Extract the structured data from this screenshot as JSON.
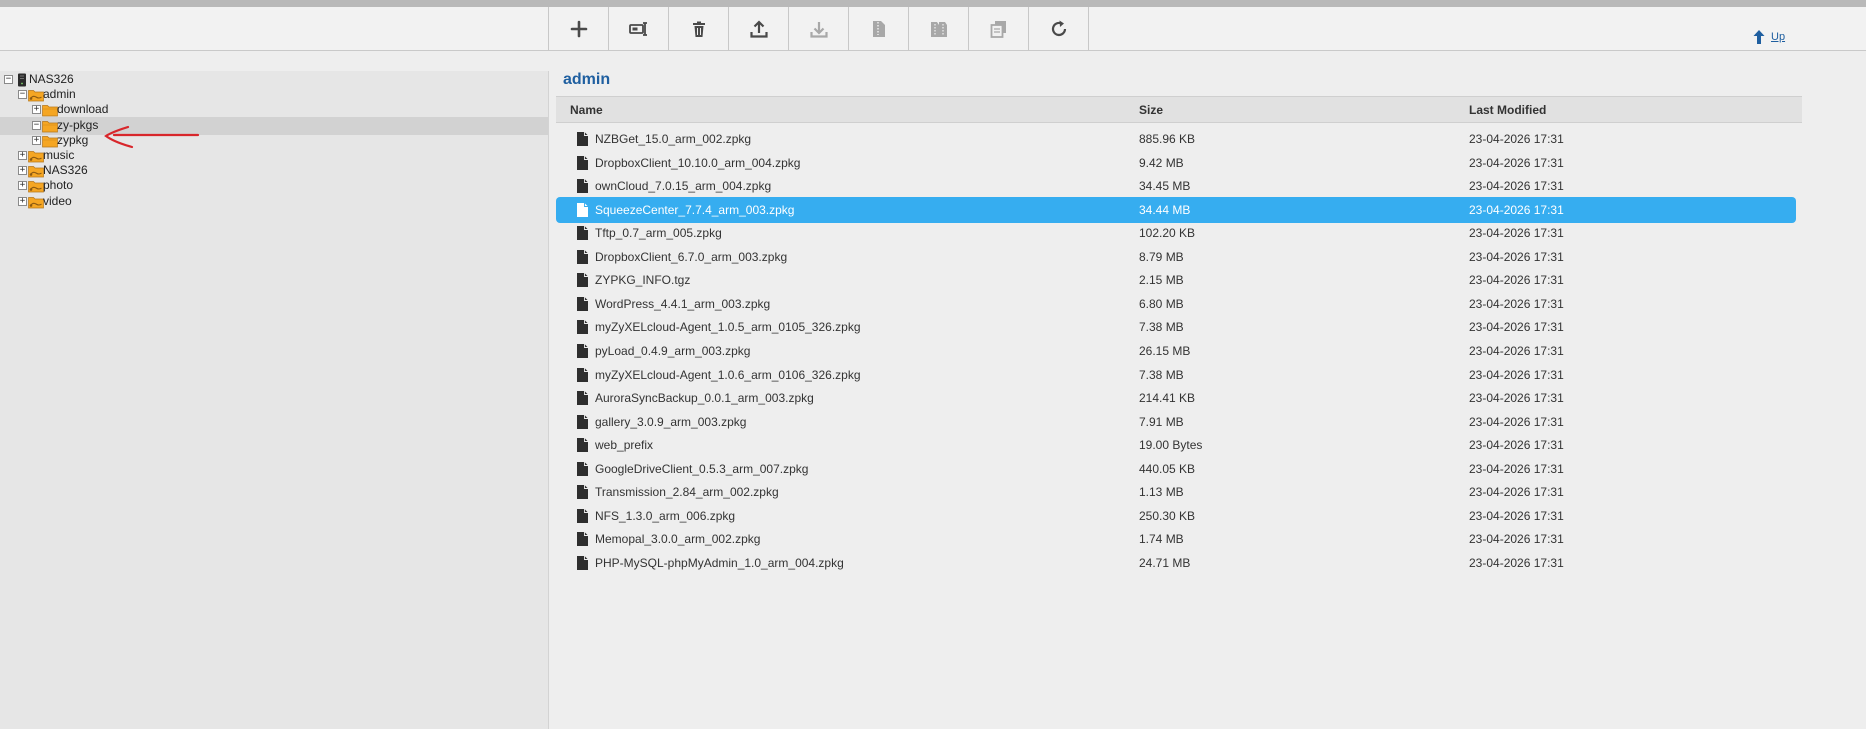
{
  "toolbar": {
    "buttons": [
      {
        "name": "add-button",
        "icon": "plus-icon",
        "enabled": true
      },
      {
        "name": "rename-button",
        "icon": "rename-icon",
        "enabled": true
      },
      {
        "name": "delete-button",
        "icon": "trash-icon",
        "enabled": true
      },
      {
        "name": "upload-button",
        "icon": "upload-icon",
        "enabled": true
      },
      {
        "name": "download-button",
        "icon": "download-icon",
        "enabled": false
      },
      {
        "name": "zip-button",
        "icon": "zip-icon",
        "enabled": false
      },
      {
        "name": "unzip-button",
        "icon": "unzip-icon",
        "enabled": false
      },
      {
        "name": "copy-move-button",
        "icon": "copy-icon",
        "enabled": false
      },
      {
        "name": "refresh-button",
        "icon": "refresh-icon",
        "enabled": true
      }
    ],
    "up_label": "Up"
  },
  "tree": {
    "items": [
      {
        "label": "NAS326",
        "level": 0,
        "expander": "−",
        "icon": "nas-icon"
      },
      {
        "label": "admin",
        "level": 1,
        "expander": "−",
        "icon": "shared-folder-icon"
      },
      {
        "label": "download",
        "level": 2,
        "expander": "+",
        "icon": "folder-icon"
      },
      {
        "label": "zy-pkgs",
        "level": 2,
        "expander": "−",
        "icon": "folder-icon",
        "selected": true
      },
      {
        "label": "zypkg",
        "level": 2,
        "expander": "+",
        "icon": "folder-icon"
      },
      {
        "label": "music",
        "level": 1,
        "expander": "+",
        "icon": "shared-folder-icon"
      },
      {
        "label": "NAS326",
        "level": 1,
        "expander": "+",
        "icon": "shared-folder-icon"
      },
      {
        "label": "photo",
        "level": 1,
        "expander": "+",
        "icon": "shared-folder-icon"
      },
      {
        "label": "video",
        "level": 1,
        "expander": "+",
        "icon": "shared-folder-icon"
      }
    ]
  },
  "main": {
    "folder_title": "admin",
    "columns": {
      "name": "Name",
      "size": "Size",
      "modified": "Last Modified"
    },
    "files": [
      {
        "name": "NZBGet_15.0_arm_002.zpkg",
        "size": "885.96 KB",
        "modified": "23-04-2026 17:31"
      },
      {
        "name": "DropboxClient_10.10.0_arm_004.zpkg",
        "size": "9.42 MB",
        "modified": "23-04-2026 17:31"
      },
      {
        "name": "ownCloud_7.0.15_arm_004.zpkg",
        "size": "34.45 MB",
        "modified": "23-04-2026 17:31"
      },
      {
        "name": "SqueezeCenter_7.7.4_arm_003.zpkg",
        "size": "34.44 MB",
        "modified": "23-04-2026 17:31",
        "selected": true
      },
      {
        "name": "Tftp_0.7_arm_005.zpkg",
        "size": "102.20 KB",
        "modified": "23-04-2026 17:31"
      },
      {
        "name": "DropboxClient_6.7.0_arm_003.zpkg",
        "size": "8.79 MB",
        "modified": "23-04-2026 17:31"
      },
      {
        "name": "ZYPKG_INFO.tgz",
        "size": "2.15 MB",
        "modified": "23-04-2026 17:31"
      },
      {
        "name": "WordPress_4.4.1_arm_003.zpkg",
        "size": "6.80 MB",
        "modified": "23-04-2026 17:31"
      },
      {
        "name": "myZyXELcloud-Agent_1.0.5_arm_0105_326.zpkg",
        "size": "7.38 MB",
        "modified": "23-04-2026 17:31"
      },
      {
        "name": "pyLoad_0.4.9_arm_003.zpkg",
        "size": "26.15 MB",
        "modified": "23-04-2026 17:31"
      },
      {
        "name": "myZyXELcloud-Agent_1.0.6_arm_0106_326.zpkg",
        "size": "7.38 MB",
        "modified": "23-04-2026 17:31"
      },
      {
        "name": "AuroraSyncBackup_0.0.1_arm_003.zpkg",
        "size": "214.41 KB",
        "modified": "23-04-2026 17:31"
      },
      {
        "name": "gallery_3.0.9_arm_003.zpkg",
        "size": "7.91 MB",
        "modified": "23-04-2026 17:31"
      },
      {
        "name": "web_prefix",
        "size": "19.00 Bytes",
        "modified": "23-04-2026 17:31"
      },
      {
        "name": "GoogleDriveClient_0.5.3_arm_007.zpkg",
        "size": "440.05 KB",
        "modified": "23-04-2026 17:31"
      },
      {
        "name": "Transmission_2.84_arm_002.zpkg",
        "size": "1.13 MB",
        "modified": "23-04-2026 17:31"
      },
      {
        "name": "NFS_1.3.0_arm_006.zpkg",
        "size": "250.30 KB",
        "modified": "23-04-2026 17:31"
      },
      {
        "name": "Memopal_3.0.0_arm_002.zpkg",
        "size": "1.74 MB",
        "modified": "23-04-2026 17:31"
      },
      {
        "name": "PHP-MySQL-phpMyAdmin_1.0_arm_004.zpkg",
        "size": "24.71 MB",
        "modified": "23-04-2026 17:31"
      }
    ]
  },
  "colors": {
    "accent": "#1f5fa0",
    "selection": "#36adf0",
    "annotation_arrow": "#d8262b",
    "folder": "#f5a623",
    "icon_enabled": "#4a4a4a",
    "icon_disabled": "#a8a8a8"
  }
}
